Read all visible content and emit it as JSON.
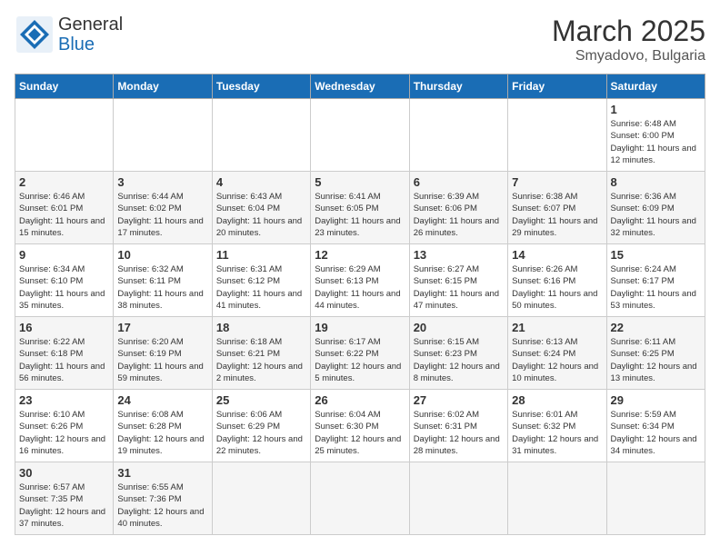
{
  "header": {
    "logo_general": "General",
    "logo_blue": "Blue",
    "month_title": "March 2025",
    "location": "Smyadovo, Bulgaria"
  },
  "days_of_week": [
    "Sunday",
    "Monday",
    "Tuesday",
    "Wednesday",
    "Thursday",
    "Friday",
    "Saturday"
  ],
  "weeks": [
    [
      {
        "day": "",
        "info": ""
      },
      {
        "day": "",
        "info": ""
      },
      {
        "day": "",
        "info": ""
      },
      {
        "day": "",
        "info": ""
      },
      {
        "day": "",
        "info": ""
      },
      {
        "day": "",
        "info": ""
      },
      {
        "day": "1",
        "info": "Sunrise: 6:48 AM\nSunset: 6:00 PM\nDaylight: 11 hours and 12 minutes."
      }
    ],
    [
      {
        "day": "2",
        "info": "Sunrise: 6:46 AM\nSunset: 6:01 PM\nDaylight: 11 hours and 15 minutes."
      },
      {
        "day": "3",
        "info": "Sunrise: 6:44 AM\nSunset: 6:02 PM\nDaylight: 11 hours and 17 minutes."
      },
      {
        "day": "4",
        "info": "Sunrise: 6:43 AM\nSunset: 6:04 PM\nDaylight: 11 hours and 20 minutes."
      },
      {
        "day": "5",
        "info": "Sunrise: 6:41 AM\nSunset: 6:05 PM\nDaylight: 11 hours and 23 minutes."
      },
      {
        "day": "6",
        "info": "Sunrise: 6:39 AM\nSunset: 6:06 PM\nDaylight: 11 hours and 26 minutes."
      },
      {
        "day": "7",
        "info": "Sunrise: 6:38 AM\nSunset: 6:07 PM\nDaylight: 11 hours and 29 minutes."
      },
      {
        "day": "8",
        "info": "Sunrise: 6:36 AM\nSunset: 6:09 PM\nDaylight: 11 hours and 32 minutes."
      }
    ],
    [
      {
        "day": "9",
        "info": "Sunrise: 6:34 AM\nSunset: 6:10 PM\nDaylight: 11 hours and 35 minutes."
      },
      {
        "day": "10",
        "info": "Sunrise: 6:32 AM\nSunset: 6:11 PM\nDaylight: 11 hours and 38 minutes."
      },
      {
        "day": "11",
        "info": "Sunrise: 6:31 AM\nSunset: 6:12 PM\nDaylight: 11 hours and 41 minutes."
      },
      {
        "day": "12",
        "info": "Sunrise: 6:29 AM\nSunset: 6:13 PM\nDaylight: 11 hours and 44 minutes."
      },
      {
        "day": "13",
        "info": "Sunrise: 6:27 AM\nSunset: 6:15 PM\nDaylight: 11 hours and 47 minutes."
      },
      {
        "day": "14",
        "info": "Sunrise: 6:26 AM\nSunset: 6:16 PM\nDaylight: 11 hours and 50 minutes."
      },
      {
        "day": "15",
        "info": "Sunrise: 6:24 AM\nSunset: 6:17 PM\nDaylight: 11 hours and 53 minutes."
      }
    ],
    [
      {
        "day": "16",
        "info": "Sunrise: 6:22 AM\nSunset: 6:18 PM\nDaylight: 11 hours and 56 minutes."
      },
      {
        "day": "17",
        "info": "Sunrise: 6:20 AM\nSunset: 6:19 PM\nDaylight: 11 hours and 59 minutes."
      },
      {
        "day": "18",
        "info": "Sunrise: 6:18 AM\nSunset: 6:21 PM\nDaylight: 12 hours and 2 minutes."
      },
      {
        "day": "19",
        "info": "Sunrise: 6:17 AM\nSunset: 6:22 PM\nDaylight: 12 hours and 5 minutes."
      },
      {
        "day": "20",
        "info": "Sunrise: 6:15 AM\nSunset: 6:23 PM\nDaylight: 12 hours and 8 minutes."
      },
      {
        "day": "21",
        "info": "Sunrise: 6:13 AM\nSunset: 6:24 PM\nDaylight: 12 hours and 10 minutes."
      },
      {
        "day": "22",
        "info": "Sunrise: 6:11 AM\nSunset: 6:25 PM\nDaylight: 12 hours and 13 minutes."
      }
    ],
    [
      {
        "day": "23",
        "info": "Sunrise: 6:10 AM\nSunset: 6:26 PM\nDaylight: 12 hours and 16 minutes."
      },
      {
        "day": "24",
        "info": "Sunrise: 6:08 AM\nSunset: 6:28 PM\nDaylight: 12 hours and 19 minutes."
      },
      {
        "day": "25",
        "info": "Sunrise: 6:06 AM\nSunset: 6:29 PM\nDaylight: 12 hours and 22 minutes."
      },
      {
        "day": "26",
        "info": "Sunrise: 6:04 AM\nSunset: 6:30 PM\nDaylight: 12 hours and 25 minutes."
      },
      {
        "day": "27",
        "info": "Sunrise: 6:02 AM\nSunset: 6:31 PM\nDaylight: 12 hours and 28 minutes."
      },
      {
        "day": "28",
        "info": "Sunrise: 6:01 AM\nSunset: 6:32 PM\nDaylight: 12 hours and 31 minutes."
      },
      {
        "day": "29",
        "info": "Sunrise: 5:59 AM\nSunset: 6:34 PM\nDaylight: 12 hours and 34 minutes."
      }
    ],
    [
      {
        "day": "30",
        "info": "Sunrise: 6:57 AM\nSunset: 7:35 PM\nDaylight: 12 hours and 37 minutes."
      },
      {
        "day": "31",
        "info": "Sunrise: 6:55 AM\nSunset: 7:36 PM\nDaylight: 12 hours and 40 minutes."
      },
      {
        "day": "",
        "info": ""
      },
      {
        "day": "",
        "info": ""
      },
      {
        "day": "",
        "info": ""
      },
      {
        "day": "",
        "info": ""
      },
      {
        "day": "",
        "info": ""
      }
    ]
  ]
}
